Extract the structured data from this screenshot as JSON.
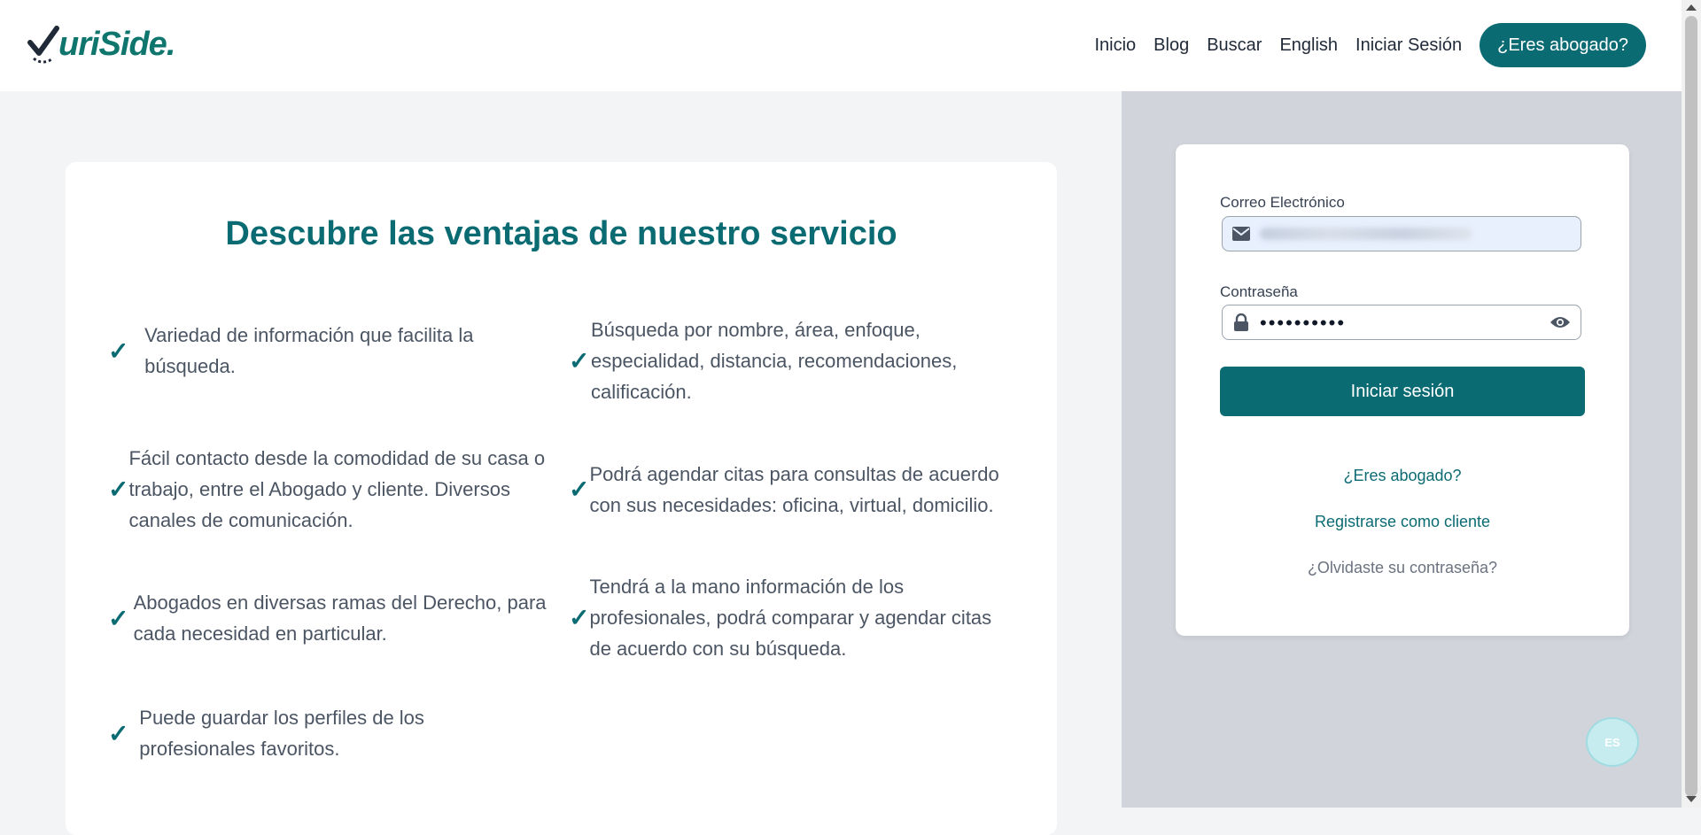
{
  "header": {
    "logo_text": "uriSide",
    "logo_dot": ".",
    "nav": [
      "Inicio",
      "Blog",
      "Buscar",
      "English",
      "Iniciar Sesión"
    ],
    "cta": "¿Eres abogado?"
  },
  "benefits": {
    "title": "Descubre las ventajas de nuestro servicio",
    "check": "✓",
    "items": [
      "Variedad de información que facilita la búsqueda.",
      "Búsqueda por nombre, área, enfoque, especialidad, distancia, recomendaciones, calificación.",
      "Fácil contacto desde la comodidad de su casa o trabajo, entre el Abogado y cliente. Diversos canales de comunicación.",
      "Podrá agendar citas para consultas de acuerdo con sus necesidades: oficina, virtual, domicilio.",
      "Abogados en diversas ramas del Derecho, para cada necesidad en particular.",
      "Tendrá a la mano información de los profesionales, podrá comparar y agendar citas de acuerdo con su búsqueda.",
      "Puede guardar los perfiles de los profesionales favoritos."
    ]
  },
  "login": {
    "email_label": "Correo Electrónico",
    "password_label": "Contraseña",
    "password_mask": "••••••••••",
    "submit": "Iniciar sesión",
    "lawyer_link": "¿Eres abogado?",
    "register_link": "Registrarse como cliente",
    "forgot_link": "¿Olvidaste su contraseña?"
  },
  "lang_badge": "ES",
  "colors": {
    "brand": "#0b6b73",
    "panel": "#d1d5db",
    "page": "#f3f4f6"
  }
}
